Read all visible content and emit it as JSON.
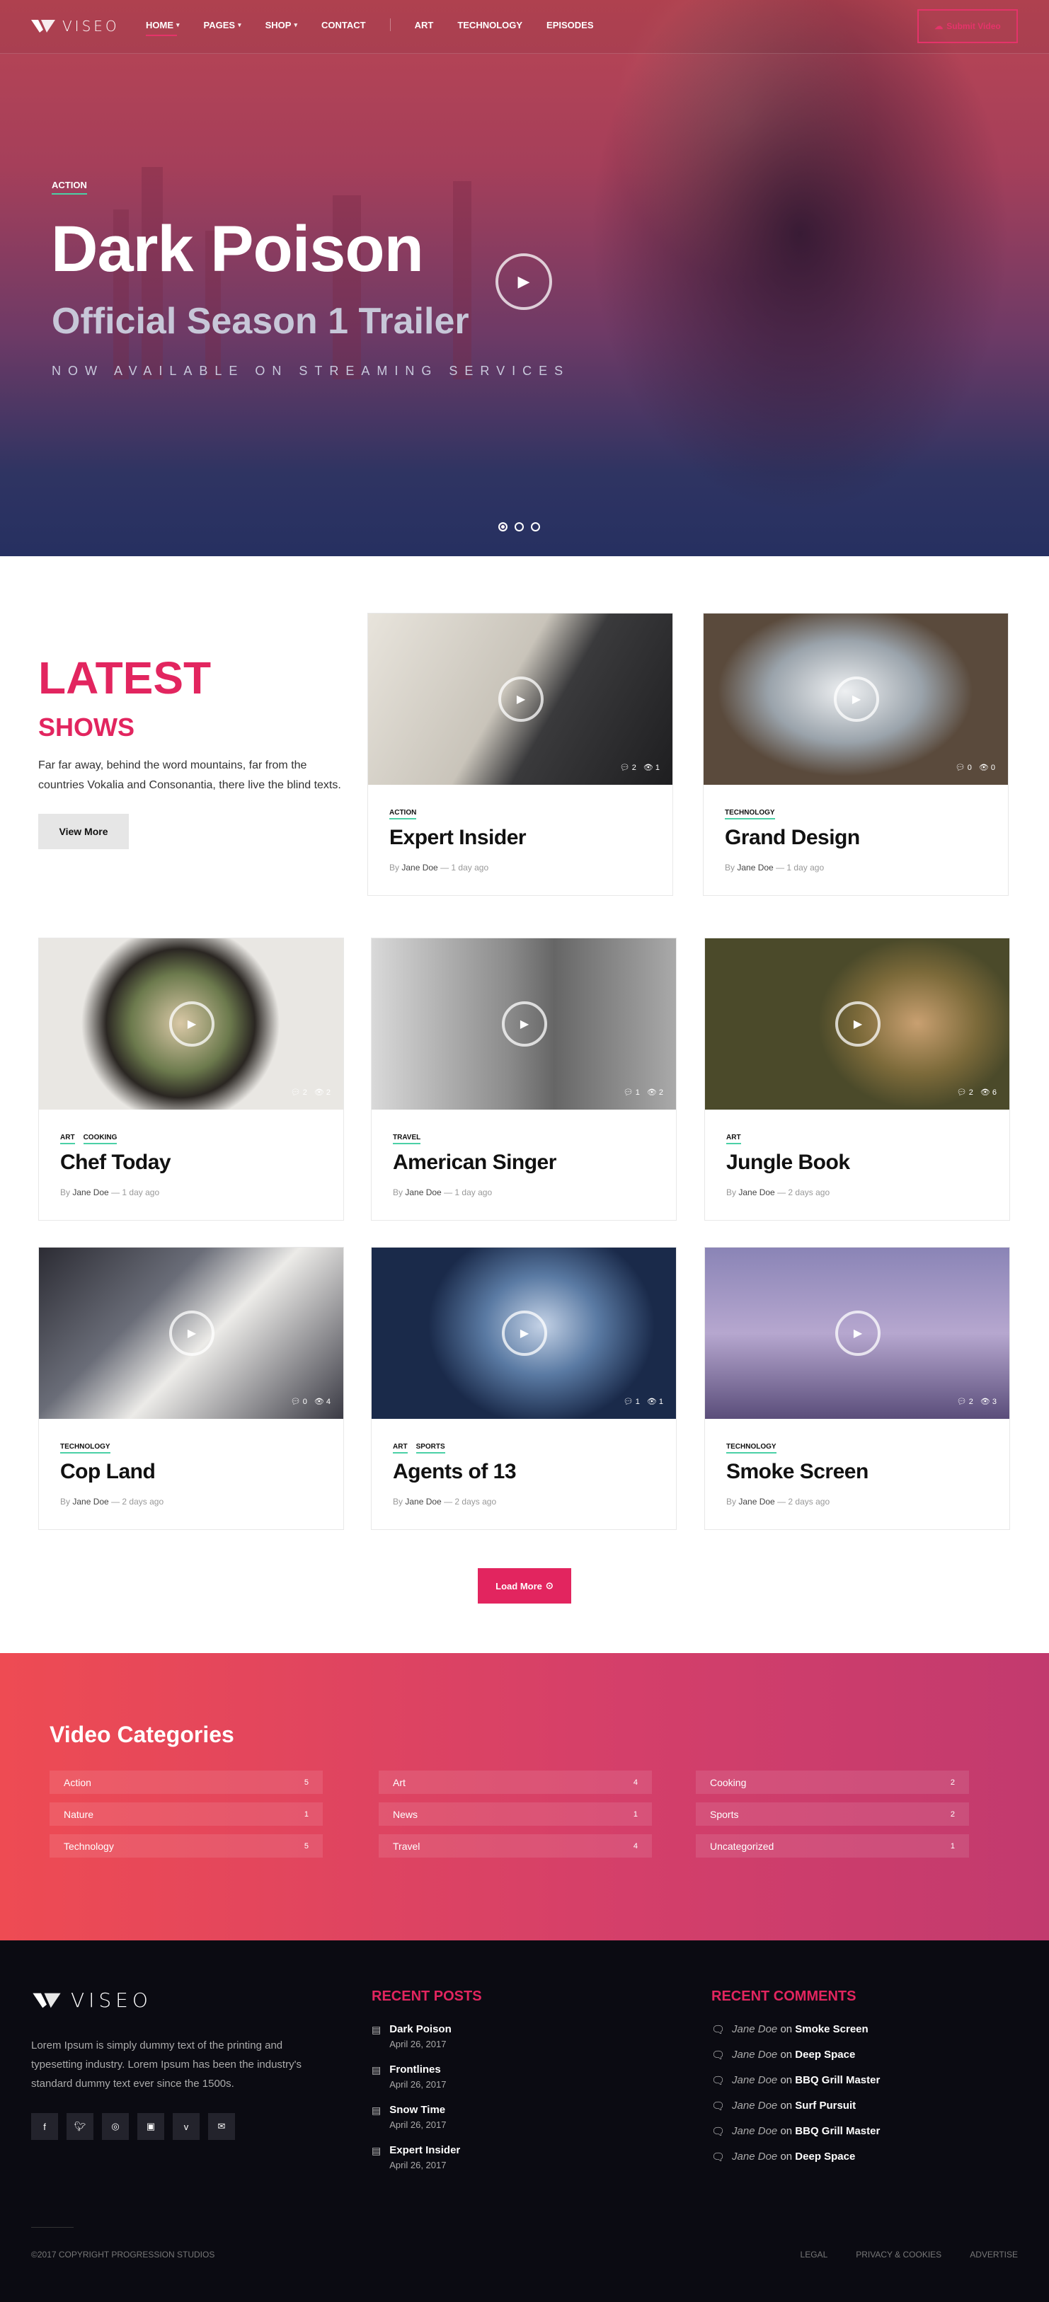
{
  "brand": {
    "name": "VISEO"
  },
  "nav": {
    "items": [
      {
        "label": "HOME",
        "dropdown": true,
        "active": true
      },
      {
        "label": "PAGES",
        "dropdown": true
      },
      {
        "label": "SHOP",
        "dropdown": true
      },
      {
        "label": "CONTACT",
        "dropdown": false
      }
    ],
    "secondary": [
      "ART",
      "TECHNOLOGY",
      "EPISODES"
    ],
    "submit_label": "Submit Video"
  },
  "hero": {
    "category": "ACTION",
    "title": "Dark Poison",
    "subtitle": "Official Season 1 Trailer",
    "tagline": "NOW AVAILABLE ON STREAMING SERVICES",
    "slides": 3,
    "active_slide": 1
  },
  "latest": {
    "title": "LATEST",
    "subtitle": "SHOWS",
    "description": "Far far away, behind the word mountains, far from the countries Vokalia and Consonantia, there live the blind texts.",
    "button": "View More"
  },
  "cards": [
    {
      "cats": [
        "ACTION"
      ],
      "title": "Expert Insider",
      "author": "Jane Doe",
      "ago": "— 1 day ago",
      "comments": "2",
      "views": "1"
    },
    {
      "cats": [
        "TECHNOLOGY"
      ],
      "title": "Grand Design",
      "author": "Jane Doe",
      "ago": "— 1 day ago",
      "comments": "0",
      "views": "0"
    },
    {
      "cats": [
        "ART",
        "COOKING"
      ],
      "title": "Chef Today",
      "author": "Jane Doe",
      "ago": "— 1 day ago",
      "comments": "2",
      "views": "2"
    },
    {
      "cats": [
        "TRAVEL"
      ],
      "title": "American Singer",
      "author": "Jane Doe",
      "ago": "— 1 day ago",
      "comments": "1",
      "views": "2"
    },
    {
      "cats": [
        "ART"
      ],
      "title": "Jungle Book",
      "author": "Jane Doe",
      "ago": "— 2 days ago",
      "comments": "2",
      "views": "6"
    },
    {
      "cats": [
        "TECHNOLOGY"
      ],
      "title": "Cop Land",
      "author": "Jane Doe",
      "ago": "— 2 days ago",
      "comments": "0",
      "views": "4"
    },
    {
      "cats": [
        "ART",
        "SPORTS"
      ],
      "title": "Agents of 13",
      "author": "Jane Doe",
      "ago": "— 2 days ago",
      "comments": "1",
      "views": "1"
    },
    {
      "cats": [
        "TECHNOLOGY"
      ],
      "title": "Smoke Screen",
      "author": "Jane Doe",
      "ago": "— 2 days ago",
      "comments": "2",
      "views": "3"
    }
  ],
  "byline_prefix": "By",
  "load_more": "Load More",
  "video_categories": {
    "title": "Video Categories",
    "items": [
      {
        "name": "Action",
        "count": "5"
      },
      {
        "name": "Art",
        "count": "4"
      },
      {
        "name": "Cooking",
        "count": "2"
      },
      {
        "name": "Nature",
        "count": "1"
      },
      {
        "name": "News",
        "count": "1"
      },
      {
        "name": "Sports",
        "count": "2"
      },
      {
        "name": "Technology",
        "count": "5"
      },
      {
        "name": "Travel",
        "count": "4"
      },
      {
        "name": "Uncategorized",
        "count": "1"
      }
    ]
  },
  "footer": {
    "about": "Lorem Ipsum is simply dummy text of the printing and typesetting industry. Lorem Ipsum has been the industry's standard dummy text ever since the 1500s.",
    "social": [
      "facebook-icon",
      "twitter-icon",
      "instagram-icon",
      "youtube-icon",
      "vimeo-icon",
      "email-icon"
    ],
    "recent_posts_title": "RECENT POSTS",
    "recent_posts": [
      {
        "title": "Dark Poison",
        "date": "April 26, 2017"
      },
      {
        "title": "Frontlines",
        "date": "April 26, 2017"
      },
      {
        "title": "Snow Time",
        "date": "April 26, 2017"
      },
      {
        "title": "Expert Insider",
        "date": "April 26, 2017"
      }
    ],
    "recent_comments_title": "RECENT COMMENTS",
    "comment_joiner": "on",
    "recent_comments": [
      {
        "author": "Jane Doe",
        "post": "Smoke Screen"
      },
      {
        "author": "Jane Doe",
        "post": "Deep Space"
      },
      {
        "author": "Jane Doe",
        "post": "BBQ Grill Master"
      },
      {
        "author": "Jane Doe",
        "post": "Surf Pursuit"
      },
      {
        "author": "Jane Doe",
        "post": "BBQ Grill Master"
      },
      {
        "author": "Jane Doe",
        "post": "Deep Space"
      }
    ],
    "copyright": "©2017 COPYRIGHT PROGRESSION STUDIOS",
    "links": [
      "LEGAL",
      "PRIVACY & COOKIES",
      "ADVERTISE"
    ]
  },
  "colors": {
    "accent": "#e2255f",
    "category_underline": "#4bd0a6",
    "footer_bg": "#0b0b12"
  }
}
